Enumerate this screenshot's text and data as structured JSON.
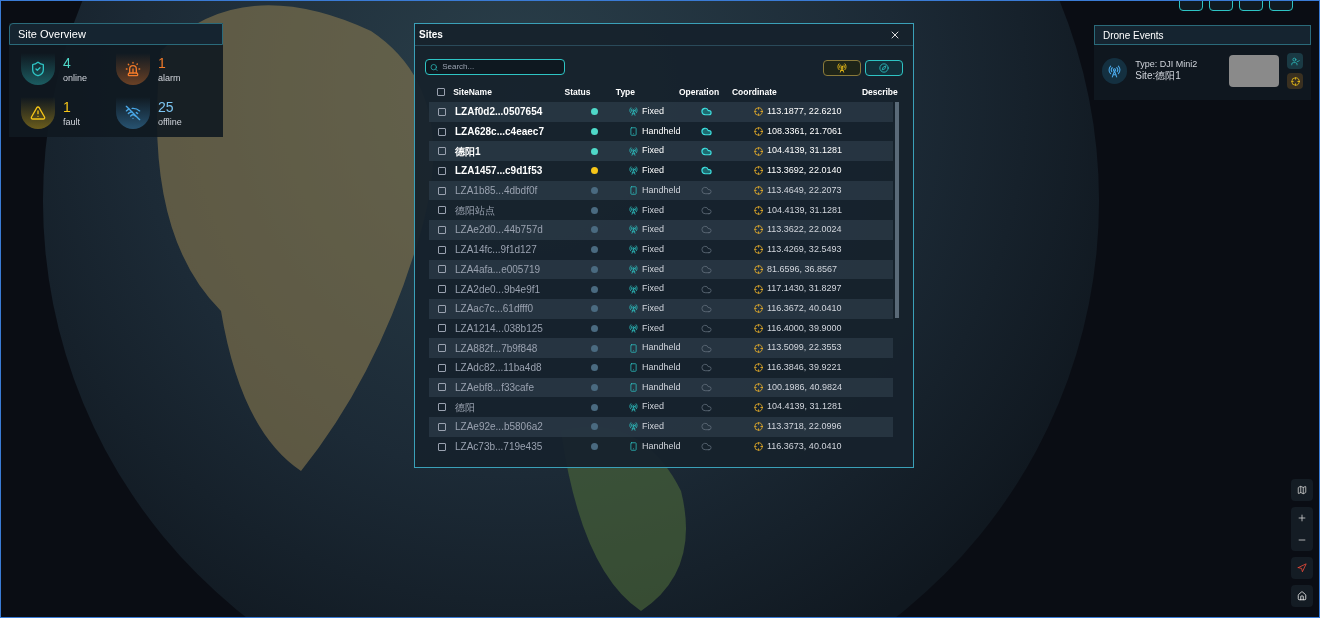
{
  "site_overview": {
    "title": "Site Overview",
    "stats": [
      {
        "kind": "online",
        "value": "4",
        "label": "online"
      },
      {
        "kind": "alarm",
        "value": "1",
        "label": "alarm"
      },
      {
        "kind": "fault",
        "value": "1",
        "label": "fault"
      },
      {
        "kind": "offline",
        "value": "25",
        "label": "offline"
      }
    ]
  },
  "sites": {
    "title": "Sites",
    "search": {
      "placeholder": "Search..."
    },
    "select_all": {
      "checked": false
    },
    "columns": [
      "SiteName",
      "Status",
      "Type",
      "Operation",
      "Coordinate",
      "Describe"
    ],
    "rows": [
      {
        "checked": false,
        "name": "LZAf0d2...0507654",
        "color": "#4fd8c8",
        "active": true,
        "kind": "fixed",
        "type": "Fixed",
        "coordinate": "113.1877, 22.6210"
      },
      {
        "checked": false,
        "name": "LZA628c...c4eaec7",
        "color": "#4fd8c8",
        "active": true,
        "kind": "handheld",
        "type": "Handheld",
        "coordinate": "108.3361, 21.7061"
      },
      {
        "checked": false,
        "name": "德阳1",
        "color": "#4fd8c8",
        "active": true,
        "kind": "fixed",
        "type": "Fixed",
        "coordinate": "104.4139, 31.1281"
      },
      {
        "checked": false,
        "name": "LZA1457...c9d1f53",
        "color": "#f5c518",
        "active": true,
        "kind": "fixed",
        "type": "Fixed",
        "coordinate": "113.3692, 22.0140"
      },
      {
        "checked": false,
        "name": "LZA1b85...4dbdf0f",
        "color": "#4a6a80",
        "active": false,
        "kind": "handheld",
        "type": "Handheld",
        "coordinate": "113.4649, 22.2073"
      },
      {
        "checked": false,
        "name": "德阳站点",
        "color": "#4a6a80",
        "active": false,
        "kind": "fixed",
        "type": "Fixed",
        "coordinate": "104.4139, 31.1281"
      },
      {
        "checked": false,
        "name": "LZAe2d0...44b757d",
        "color": "#4a6a80",
        "active": false,
        "kind": "fixed",
        "type": "Fixed",
        "coordinate": "113.3622, 22.0024"
      },
      {
        "checked": false,
        "name": "LZA14fc...9f1d127",
        "color": "#4a6a80",
        "active": false,
        "kind": "fixed",
        "type": "Fixed",
        "coordinate": "113.4269, 32.5493"
      },
      {
        "checked": false,
        "name": "LZA4afa...e005719",
        "color": "#4a6a80",
        "active": false,
        "kind": "fixed",
        "type": "Fixed",
        "coordinate": "81.6596, 36.8567"
      },
      {
        "checked": false,
        "name": "LZA2de0...9b4e9f1",
        "color": "#4a6a80",
        "active": false,
        "kind": "fixed",
        "type": "Fixed",
        "coordinate": "117.1430, 31.8297"
      },
      {
        "checked": false,
        "name": "LZAac7c...61dfff0",
        "color": "#4a6a80",
        "active": false,
        "kind": "fixed",
        "type": "Fixed",
        "coordinate": "116.3672, 40.0410"
      },
      {
        "checked": false,
        "name": "LZA1214...038b125",
        "color": "#4a6a80",
        "active": false,
        "kind": "fixed",
        "type": "Fixed",
        "coordinate": "116.4000, 39.9000"
      },
      {
        "checked": false,
        "name": "LZA882f...7b9f848",
        "color": "#4a6a80",
        "active": false,
        "kind": "handheld",
        "type": "Handheld",
        "coordinate": "113.5099, 22.3553"
      },
      {
        "checked": false,
        "name": "LZAdc82...11ba4d8",
        "color": "#4a6a80",
        "active": false,
        "kind": "handheld",
        "type": "Handheld",
        "coordinate": "116.3846, 39.9221"
      },
      {
        "checked": false,
        "name": "LZAebf8...f33cafe",
        "color": "#4a6a80",
        "active": false,
        "kind": "handheld",
        "type": "Handheld",
        "coordinate": "100.1986, 40.9824"
      },
      {
        "checked": false,
        "name": "德阳",
        "color": "#4a6a80",
        "active": false,
        "kind": "fixed",
        "type": "Fixed",
        "coordinate": "104.4139, 31.1281"
      },
      {
        "checked": false,
        "name": "LZAe92e...b5806a2",
        "color": "#4a6a80",
        "active": false,
        "kind": "fixed",
        "type": "Fixed",
        "coordinate": "113.3718, 22.0996"
      },
      {
        "checked": false,
        "name": "LZAc73b...719e435",
        "color": "#4a6a80",
        "active": false,
        "kind": "handheld",
        "type": "Handheld",
        "coordinate": "116.3673, 40.0410"
      }
    ]
  },
  "drone_events": {
    "title": "Drone Events",
    "events": [
      {
        "type_label": "Type:",
        "type": "DJI Mini2",
        "site_label": "Site:",
        "site": "德阳1"
      }
    ]
  }
}
